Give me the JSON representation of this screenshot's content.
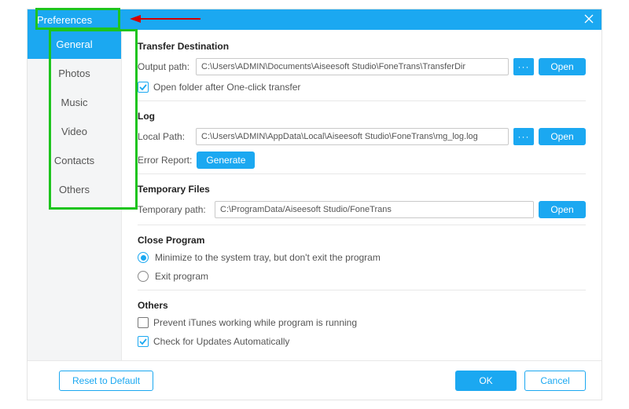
{
  "window": {
    "title": "Preferences"
  },
  "sidebar": {
    "tabs": [
      {
        "label": "General"
      },
      {
        "label": "Photos"
      },
      {
        "label": "Music"
      },
      {
        "label": "Video"
      },
      {
        "label": "Contacts"
      },
      {
        "label": "Others"
      }
    ]
  },
  "transfer": {
    "heading": "Transfer Destination",
    "output_label": "Output path:",
    "output_path": "C:\\Users\\ADMIN\\Documents\\Aiseesoft Studio\\FoneTrans\\TransferDir",
    "open_folder_after_label": "Open folder after One-click transfer"
  },
  "log": {
    "heading": "Log",
    "local_label": "Local Path:",
    "local_path": "C:\\Users\\ADMIN\\AppData\\Local\\Aiseesoft Studio\\FoneTrans\\mg_log.log",
    "error_report_label": "Error Report:",
    "generate_label": "Generate"
  },
  "temp": {
    "heading": "Temporary Files",
    "temp_label": "Temporary path:",
    "temp_path": "C:\\ProgramData/Aiseesoft Studio/FoneTrans"
  },
  "close_program": {
    "heading": "Close Program",
    "minimize_label": "Minimize to the system tray, but don't exit the program",
    "exit_label": "Exit program"
  },
  "others": {
    "heading": "Others",
    "prevent_itunes_label": "Prevent iTunes working while program is running",
    "check_updates_label": "Check for Updates Automatically"
  },
  "buttons": {
    "open": "Open",
    "browse": "···",
    "reset": "Reset to Default",
    "ok": "OK",
    "cancel": "Cancel"
  }
}
